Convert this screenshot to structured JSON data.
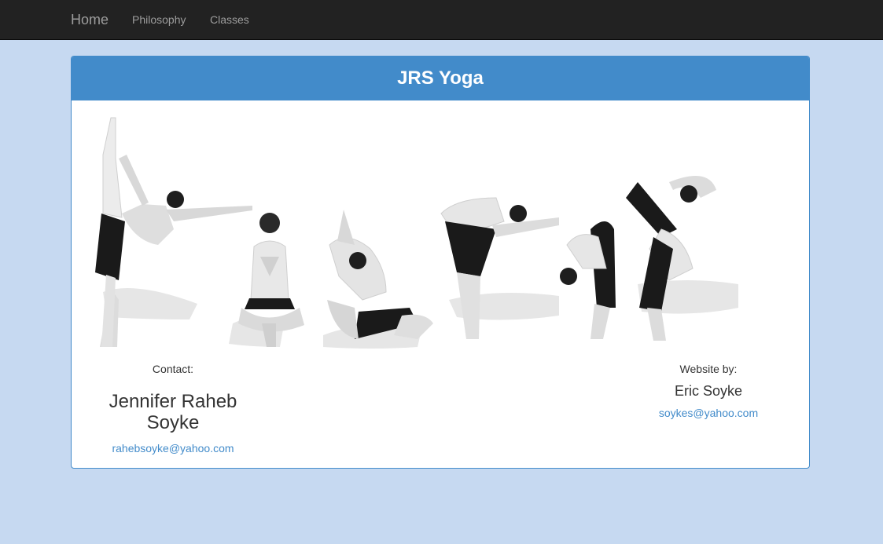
{
  "nav": {
    "brand": "Home",
    "links": [
      "Philosophy",
      "Classes"
    ]
  },
  "panel": {
    "title": "JRS Yoga"
  },
  "contact": {
    "label": "Contact:",
    "name": "Jennifer Raheb Soyke",
    "email": "rahebsoyke@yahoo.com"
  },
  "credit": {
    "label": "Website by:",
    "name": "Eric Soyke",
    "email": "soykes@yahoo.com"
  },
  "colors": {
    "page_bg": "#c6d9f1",
    "navbar_bg": "#222222",
    "panel_accent": "#428bca",
    "link": "#428bca"
  },
  "icons": [
    "yoga-poses-photo"
  ]
}
